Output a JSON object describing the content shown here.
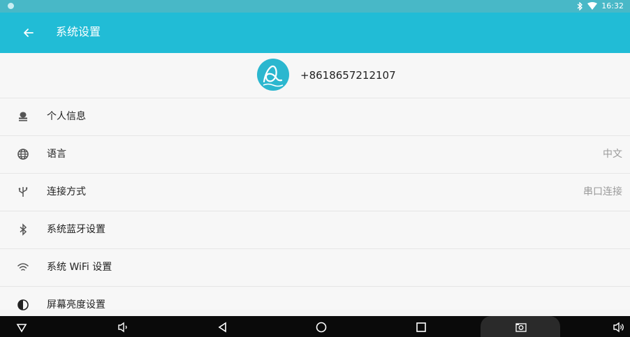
{
  "status_bar": {
    "time": "16:32",
    "icons": [
      "bluetooth-icon",
      "wifi-icon"
    ]
  },
  "app_bar": {
    "back_icon": "arrow-left-icon",
    "title": "系统设置"
  },
  "profile": {
    "phone": "+8618657212107"
  },
  "settings": [
    {
      "icon": "person-icon",
      "label": "个人信息",
      "value": ""
    },
    {
      "icon": "globe-icon",
      "label": "语言",
      "value": "中文"
    },
    {
      "icon": "usb-icon",
      "label": "连接方式",
      "value": "串口连接"
    },
    {
      "icon": "bluetooth-icon",
      "label": "系统蓝牙设置",
      "value": ""
    },
    {
      "icon": "wifi-icon",
      "label": "系统 WiFi 设置",
      "value": ""
    },
    {
      "icon": "brightness-icon",
      "label": "屏幕亮度设置",
      "value": ""
    }
  ],
  "nav_bar": [
    "hide-keyboard-icon",
    "volume-down-icon",
    "back-icon",
    "home-icon",
    "recents-icon",
    "screenshot-icon",
    "volume-up-icon"
  ],
  "colors": {
    "accent": "#21bcd6",
    "status_bar": "#48b8c7",
    "nav_bar": "#0a0a0a"
  }
}
